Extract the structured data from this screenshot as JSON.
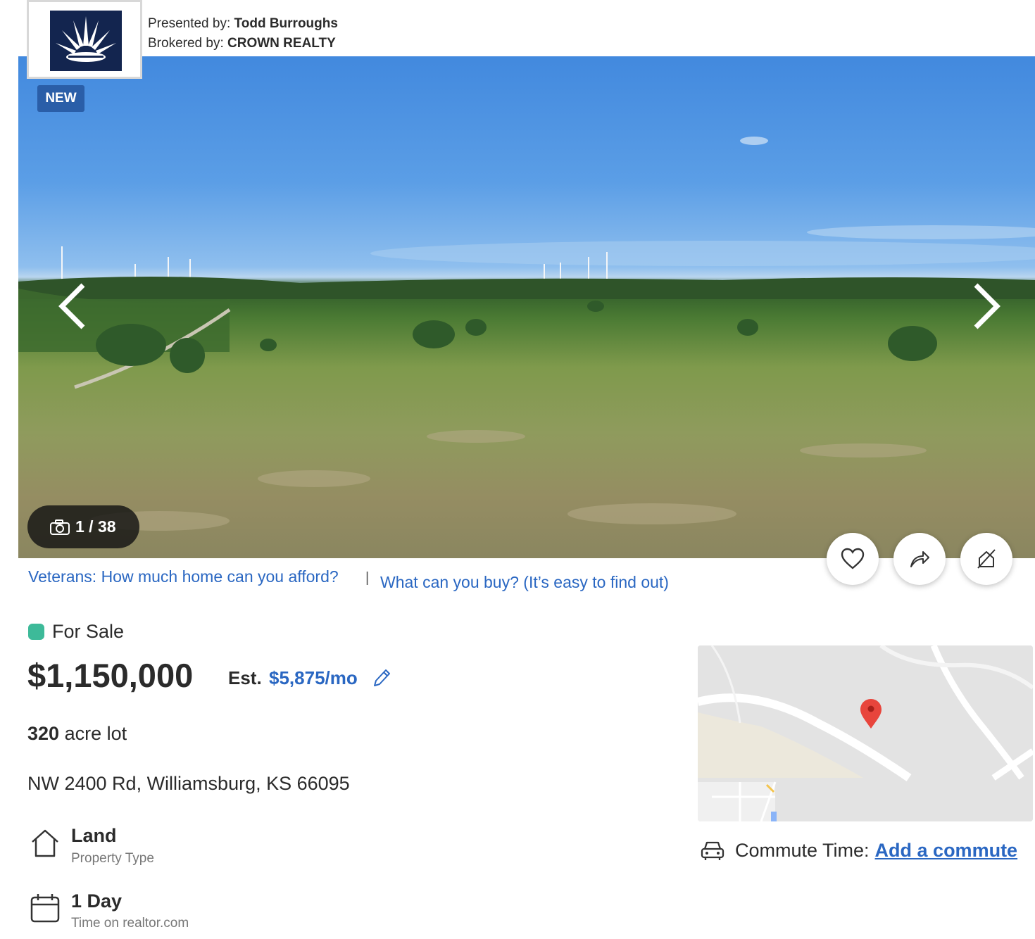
{
  "header": {
    "presented_label": "Presented by:",
    "presented_name": "Todd Burroughs",
    "brokered_label": "Brokered by:",
    "brokered_name": "CROWN REALTY"
  },
  "gallery": {
    "badge": "NEW",
    "photo_counter": "1 / 38"
  },
  "links": {
    "veterans": "Veterans: How much home can you afford?",
    "separator": "|",
    "what_can_buy": "What can you buy? (It’s easy to find out)"
  },
  "listing": {
    "status": "For Sale",
    "status_color": "#3dba99",
    "price": "$1,150,000",
    "est_label": "Est.",
    "est_value": "$5,875/mo",
    "lot_size": "320",
    "lot_unit": "acre lot",
    "address": "NW 2400 Rd, Williamsburg, KS 66095"
  },
  "facts": [
    {
      "title": "Land",
      "subtitle": "Property Type",
      "icon": "house-icon"
    },
    {
      "title": "1 Day",
      "subtitle": "Time on realtor.com",
      "icon": "calendar-icon"
    }
  ],
  "commute": {
    "label": "Commute Time:",
    "link": "Add a commute"
  },
  "colors": {
    "link_blue": "#2a67c2",
    "badge_blue": "#2a5ea8",
    "map_pin": "#e8453c"
  }
}
